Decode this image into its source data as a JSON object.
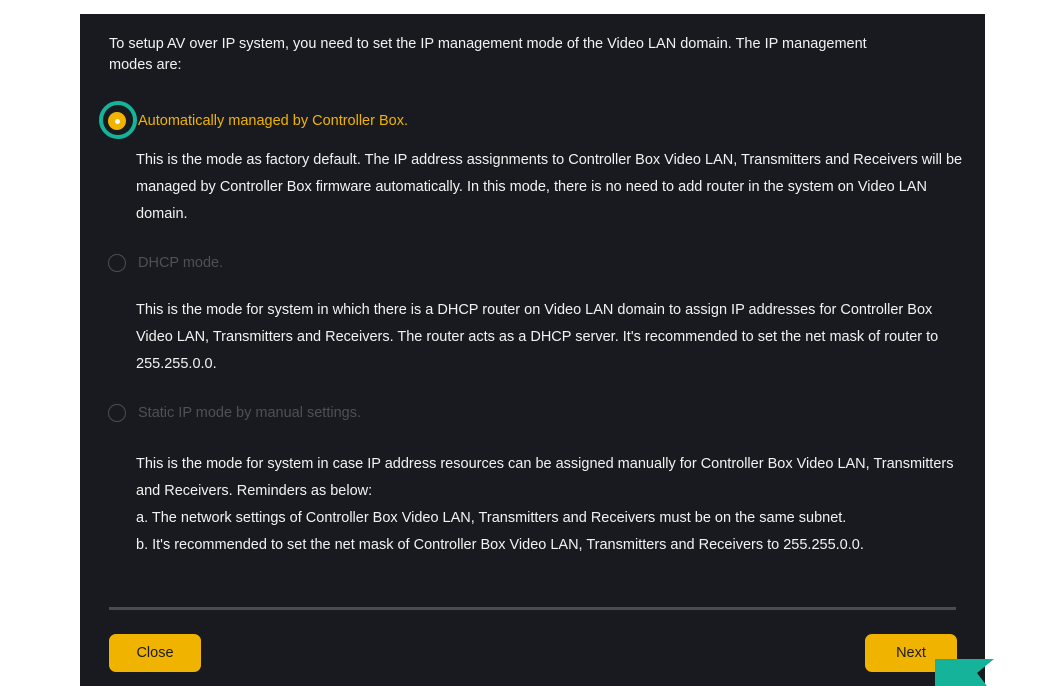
{
  "dialog": {
    "intro": "To setup AV over IP system, you need to set the IP management mode of the Video LAN domain. The IP management modes are:",
    "options": [
      {
        "label": "Automatically managed by Controller Box.",
        "selected": true,
        "description": "This is the mode as factory default. The IP address assignments to Controller Box Video LAN, Transmitters and Receivers will be managed by Controller Box firmware automatically. In this mode, there is no need to add router in the system on Video LAN domain."
      },
      {
        "label": "DHCP mode.",
        "selected": false,
        "description": "This is the mode for system in which there is a DHCP router on Video LAN domain to assign IP addresses for Controller Box Video LAN, Transmitters and Receivers. The router acts as a DHCP server. It's recommended to set the net mask of router to 255.255.0.0."
      },
      {
        "label": "Static IP mode by manual settings.",
        "selected": false,
        "description_lines": [
          "This is the mode for system in case IP address resources can be assigned manually for Controller Box Video LAN, Transmitters and Receivers. Reminders as below:",
          "a. The network settings of Controller Box Video LAN, Transmitters and Receivers must be on the same subnet.",
          "b. It's recommended to set the net mask of Controller Box Video LAN, Transmitters and Receivers to 255.255.0.0."
        ]
      }
    ],
    "buttons": {
      "close_label": "Close",
      "next_label": "Next"
    }
  },
  "colors": {
    "background": "#181a1f",
    "accent": "#f0b400",
    "highlight_ring": "#14b39a",
    "text": "#f2f2f2",
    "inactive_text": "#4d5058"
  }
}
